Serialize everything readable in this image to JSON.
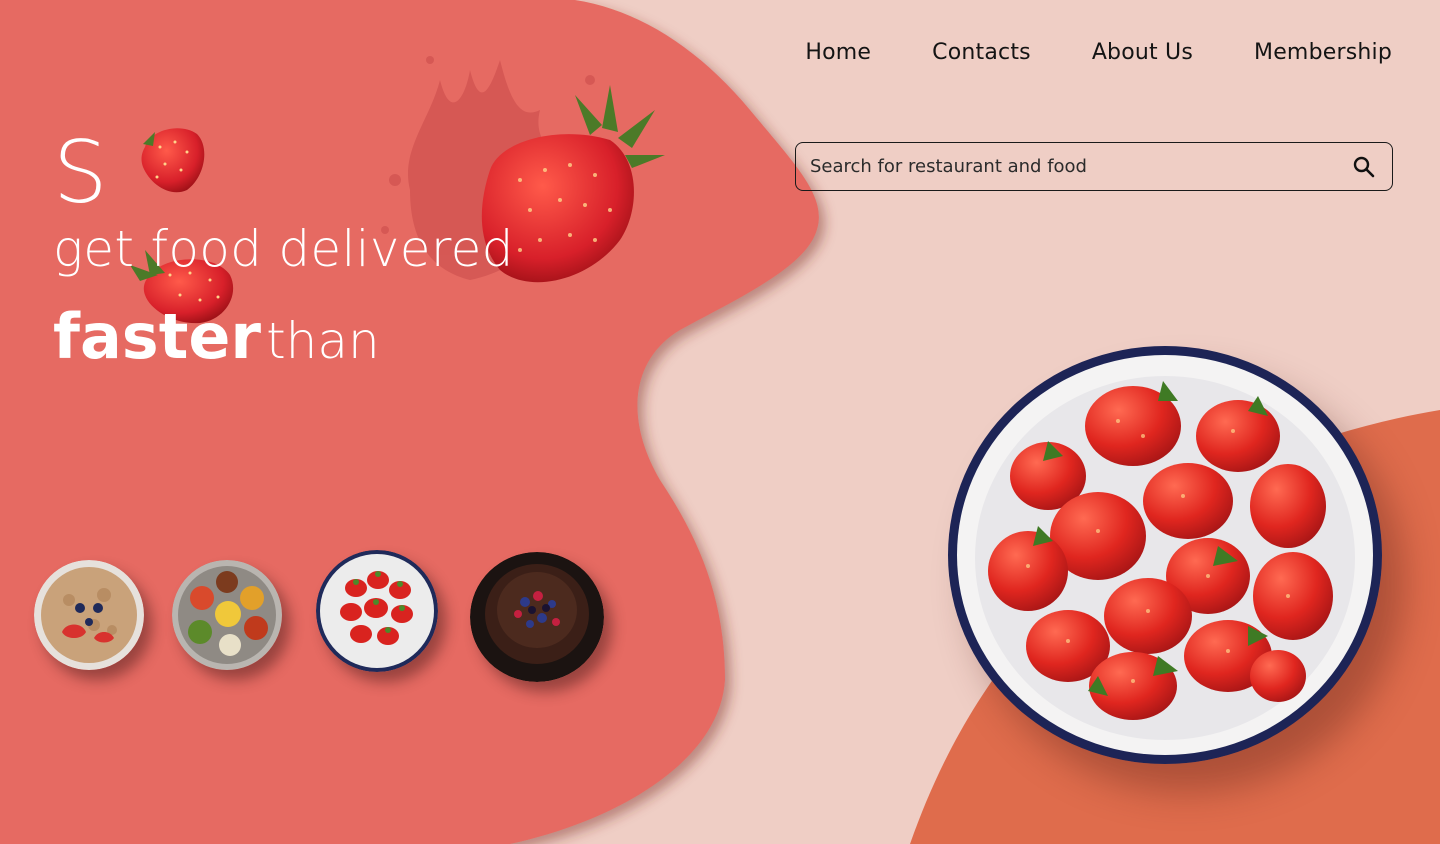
{
  "nav": {
    "home": "Home",
    "contacts": "Contacts",
    "about": "About Us",
    "membership": "Membership"
  },
  "search": {
    "placeholder": "Search for restaurant and food",
    "icon": "search-icon"
  },
  "hero": {
    "letter": "S",
    "line1": "get food delivered",
    "bold": "faster",
    "light": "than"
  },
  "thumbnails": [
    {
      "name": "oatmeal-bowl-thumbnail"
    },
    {
      "name": "thali-plate-thumbnail"
    },
    {
      "name": "strawberry-bowl-thumbnail"
    },
    {
      "name": "chocolate-cake-thumbnail"
    }
  ],
  "colors": {
    "background": "#efcec5",
    "blob": "#e66a62",
    "accent_blob": "#df6c4c",
    "text_light": "#ffffff",
    "text_dark": "#141414"
  }
}
